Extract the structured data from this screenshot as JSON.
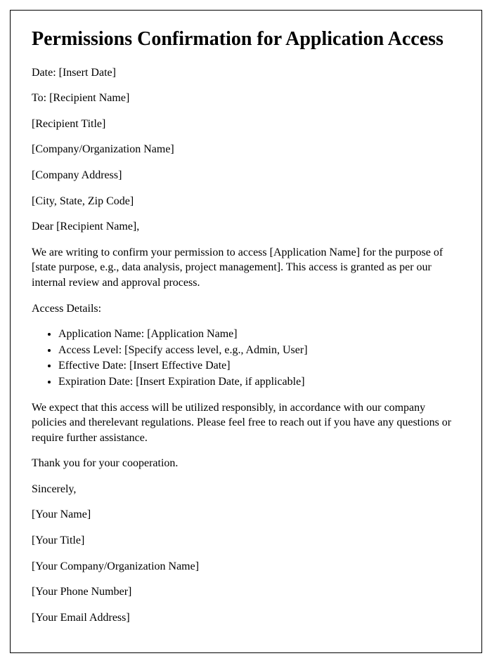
{
  "title": "Permissions Confirmation for Application Access",
  "header": {
    "date": "Date: [Insert Date]",
    "to": "To: [Recipient Name]",
    "recipient_title": "[Recipient Title]",
    "company_name": "[Company/Organization Name]",
    "company_address": "[Company Address]",
    "city_state_zip": "[City, State, Zip Code]"
  },
  "salutation": "Dear [Recipient Name],",
  "intro_paragraph": "We are writing to confirm your permission to access [Application Name] for the purpose of [state purpose, e.g., data analysis, project management]. This access is granted as per our internal review and approval process.",
  "access_details_label": "Access Details:",
  "access_details": {
    "application_name": "Application Name: [Application Name]",
    "access_level": "Access Level: [Specify access level, e.g., Admin, User]",
    "effective_date": "Effective Date: [Insert Effective Date]",
    "expiration_date": "Expiration Date: [Insert Expiration Date, if applicable]"
  },
  "responsibility_paragraph": "We expect that this access will be utilized responsibly, in accordance with our company policies and therelevant regulations. Please feel free to reach out if you have any questions or require further assistance.",
  "thank_you": "Thank you for your cooperation.",
  "closing": "Sincerely,",
  "signature": {
    "name": "[Your Name]",
    "title": "[Your Title]",
    "company": "[Your Company/Organization Name]",
    "phone": "[Your Phone Number]",
    "email": "[Your Email Address]"
  }
}
